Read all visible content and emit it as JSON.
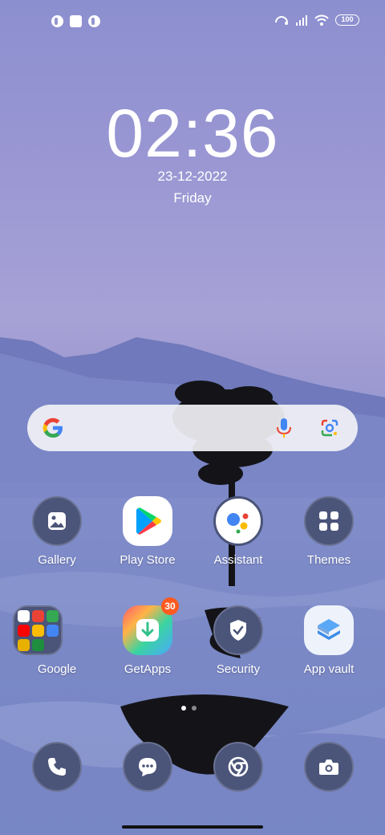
{
  "status_bar": {
    "left_icons": [
      "app-notification-icon",
      "square-notification-icon",
      "app-notification-icon"
    ],
    "right_icons": [
      "hotspot-icon",
      "signal-icon",
      "wifi-icon"
    ],
    "battery": "100"
  },
  "lockclock": {
    "time": "02:36",
    "date": "23-12-2022",
    "day": "Friday"
  },
  "search": {
    "icons": [
      "google-logo-icon",
      "microphone-icon",
      "google-lens-icon"
    ]
  },
  "apps_row1": [
    {
      "label": "Gallery",
      "icon": "gallery-icon"
    },
    {
      "label": "Play Store",
      "icon": "play-store-icon"
    },
    {
      "label": "Assistant",
      "icon": "assistant-icon"
    },
    {
      "label": "Themes",
      "icon": "themes-icon"
    }
  ],
  "apps_row2": [
    {
      "label": "Google",
      "icon": "google-folder-icon"
    },
    {
      "label": "GetApps",
      "icon": "getapps-icon",
      "badge": "30"
    },
    {
      "label": "Security",
      "icon": "security-icon"
    },
    {
      "label": "App vault",
      "icon": "app-vault-icon"
    }
  ],
  "dock": [
    "phone-icon",
    "messages-icon",
    "chrome-icon",
    "camera-icon"
  ],
  "colors": {
    "wallpaper_top": "#8c8fcf",
    "icon_bg": "#4b5479",
    "badge": "#ff5a1f"
  }
}
